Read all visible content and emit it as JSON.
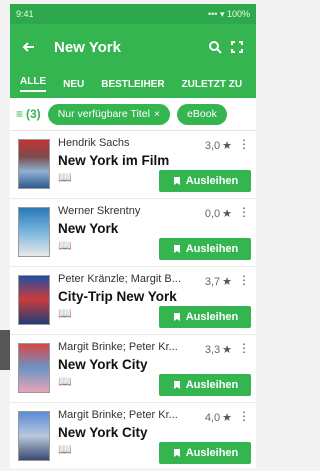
{
  "statusbar": {
    "left": "9:41",
    "right": "•••  ▾ 100%"
  },
  "header": {
    "title": "New York"
  },
  "tabs": [
    "ALLE",
    "NEU",
    "BESTLEIHER",
    "ZULETZT ZU"
  ],
  "filters": {
    "count": "(3)",
    "chip1": "Nur verfügbare Titel",
    "chip2": "eBook"
  },
  "items": [
    {
      "author": "Hendrik Sachs",
      "title": "New York im Film",
      "rating": "3,0",
      "borrow": "Ausleihen"
    },
    {
      "author": "Werner Skrentny",
      "title": "New York",
      "rating": "0,0",
      "borrow": "Ausleihen"
    },
    {
      "author": "Peter Kränzle; Margit B...",
      "title": "City-Trip New York",
      "rating": "3,7",
      "borrow": "Ausleihen"
    },
    {
      "author": "Margit Brinke; Peter Kr...",
      "title": "New York City",
      "rating": "3,3",
      "borrow": "Ausleihen"
    },
    {
      "author": "Margit Brinke; Peter Kr...",
      "title": "New York City",
      "rating": "4,0",
      "borrow": "Ausleihen"
    }
  ],
  "colors": {
    "primary": "#35b54f",
    "status": "#2ea84c"
  }
}
